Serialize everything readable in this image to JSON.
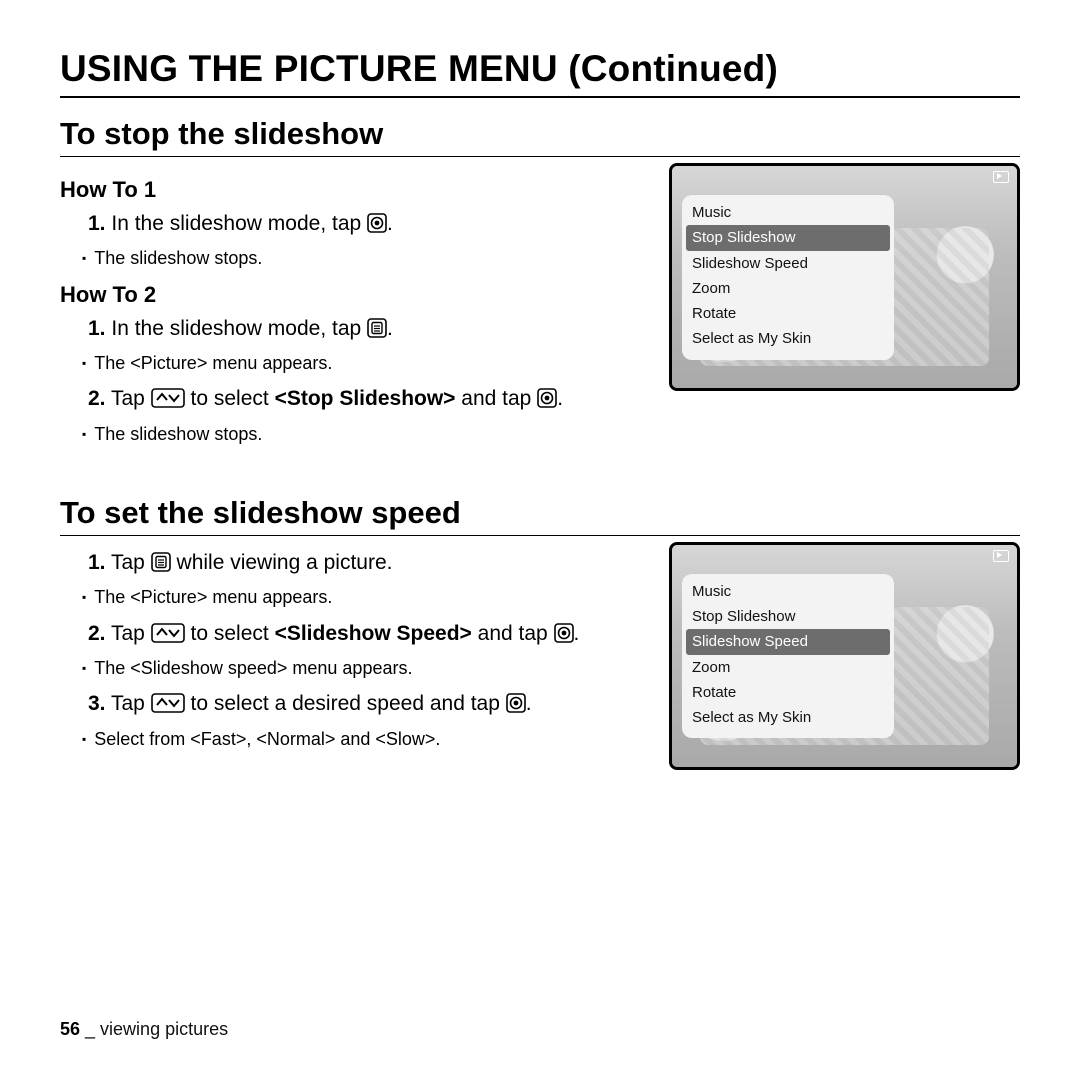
{
  "title": "USING THE PICTURE MENU (Continued)",
  "sections": {
    "stop": {
      "heading": "To stop the slideshow",
      "howto1": {
        "label": "How To 1",
        "step1_a": "In the slideshow mode, tap ",
        "step1_b": ".",
        "sub1": "The slideshow stops."
      },
      "howto2": {
        "label": "How To 2",
        "step1_a": "In the slideshow mode, tap ",
        "step1_b": ".",
        "sub1": "The <Picture> menu appears.",
        "step2_a": "Tap ",
        "step2_b": " to select ",
        "step2_bold": "<Stop Slideshow>",
        "step2_c": " and tap ",
        "step2_d": ".",
        "sub2": "The slideshow stops."
      },
      "screenshot": {
        "menu": [
          "Music",
          "Stop Slideshow",
          "Slideshow Speed",
          "Zoom",
          "Rotate",
          "Select as My Skin"
        ],
        "selected": "Stop Slideshow"
      }
    },
    "speed": {
      "heading": "To set the slideshow speed",
      "step1_a": "Tap ",
      "step1_b": " while viewing a picture.",
      "sub1": "The <Picture> menu appears.",
      "step2_a": "Tap ",
      "step2_b": " to select ",
      "step2_bold": "<Slideshow Speed>",
      "step2_c": " and tap ",
      "step2_d": ".",
      "sub2": "The <Slideshow speed> menu appears.",
      "step3_a": "Tap ",
      "step3_b": " to select a desired speed and tap ",
      "step3_c": ".",
      "sub3": "Select from <Fast>, <Normal> and <Slow>.",
      "screenshot": {
        "menu": [
          "Music",
          "Stop Slideshow",
          "Slideshow Speed",
          "Zoom",
          "Rotate",
          "Select as My Skin"
        ],
        "selected": "Slideshow Speed"
      }
    }
  },
  "icons": {
    "center": "[◉]",
    "menu": "[▤]",
    "updown": "[⌃ ⌄]"
  },
  "footer": {
    "page": "56",
    "sep": " _ ",
    "chapter": "viewing pictures"
  }
}
